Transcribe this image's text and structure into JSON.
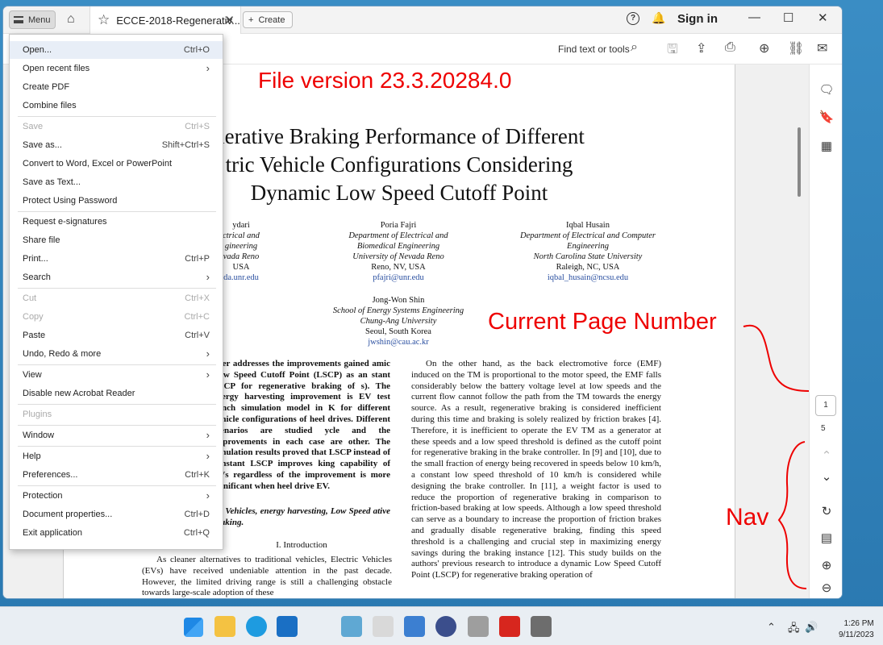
{
  "titlebar": {
    "menu_label": "Menu",
    "tab_title": "ECCE-2018-Regenerativ...",
    "create_label": "Create",
    "signin_label": "Sign in"
  },
  "toolbar": {
    "find_label": "Find text or tools"
  },
  "annotations": {
    "file_version": "File version 23.3.20284.0",
    "current_page": "Current Page Number",
    "nav": "Nav"
  },
  "navigation": {
    "current_page": "1",
    "total_pages": "5"
  },
  "menu": {
    "items": [
      {
        "label": "Open...",
        "shortcut": "Ctrl+O"
      },
      {
        "label": "Open recent files",
        "shortcut": "›"
      },
      {
        "label": "Create PDF",
        "shortcut": ""
      },
      {
        "label": "Combine files",
        "shortcut": ""
      },
      {
        "label": "Save",
        "shortcut": "Ctrl+S"
      },
      {
        "label": "Save as...",
        "shortcut": "Shift+Ctrl+S"
      },
      {
        "label": "Convert to Word, Excel or PowerPoint",
        "shortcut": ""
      },
      {
        "label": "Save as Text...",
        "shortcut": ""
      },
      {
        "label": "Protect Using Password",
        "shortcut": ""
      },
      {
        "label": "Request e-signatures",
        "shortcut": ""
      },
      {
        "label": "Share file",
        "shortcut": ""
      },
      {
        "label": "Print...",
        "shortcut": "Ctrl+P"
      },
      {
        "label": "Search",
        "shortcut": "›"
      },
      {
        "label": "Cut",
        "shortcut": "Ctrl+X"
      },
      {
        "label": "Copy",
        "shortcut": "Ctrl+C"
      },
      {
        "label": "Paste",
        "shortcut": "Ctrl+V"
      },
      {
        "label": "Undo, Redo & more",
        "shortcut": "›"
      },
      {
        "label": "View",
        "shortcut": "›"
      },
      {
        "label": "Disable new Acrobat Reader",
        "shortcut": ""
      },
      {
        "label": "Plugins",
        "shortcut": ""
      },
      {
        "label": "Window",
        "shortcut": "›"
      },
      {
        "label": "Help",
        "shortcut": "›"
      },
      {
        "label": "Preferences...",
        "shortcut": "Ctrl+K"
      },
      {
        "label": "Protection",
        "shortcut": "›"
      },
      {
        "label": "Document properties...",
        "shortcut": "Ctrl+D"
      },
      {
        "label": "Exit application",
        "shortcut": "Ctrl+Q"
      }
    ]
  },
  "document": {
    "title_lines": [
      "nerative Braking Performance of Different",
      "tric Vehicle Configurations Considering",
      "Dynamic Low Speed Cutoff Point"
    ],
    "author1": [
      "ydari",
      "ctrical and",
      "gineering",
      "vada Reno",
      "USA",
      "da.unr.edu"
    ],
    "author2": [
      "Poria Fajri",
      "Department of Electrical and",
      "Biomedical Engineering",
      "University of Nevada Reno",
      "Reno, NV, USA",
      "pfajri@unr.edu"
    ],
    "author3": [
      "Iqbal Husain",
      "Department of Electrical and Computer",
      "Engineering",
      "North Carolina State University",
      "Raleigh, NC, USA",
      "iqbal_husain@ncsu.edu"
    ],
    "author4": [
      "Jong-Won Shin",
      "School of Energy Systems Engineering",
      "Chung-Ang University",
      "Seoul, South Korea",
      "jwshin@cau.ac.kr"
    ],
    "left_col": "aper addresses the improvements gained amic Low Speed Cutoff Point (LSCP) as an stant LSCP for regenerative braking of s). The energy harvesting improvement is EV test bench simulation model in K for different vehicle configurations of heel drives. Different scenarios are studied ycle and the improvements in each case are other. The simulation results proved that LSCP instead of constant LSCP improves king capability of EVs regardless of the improvement is more significant when heel drive EV.",
    "keywords": "ric Vehicles, energy harvesting, Low Speed ative braking.",
    "section": "I.  Introduction",
    "intro": "As cleaner alternatives to traditional vehicles, Electric Vehicles (EVs) have received undeniable attention in the past decade. However, the limited driving range is still a challenging obstacle towards large-scale adoption of these",
    "right_col": "On the other hand, as the back electromotive force (EMF) induced on the TM is proportional to the motor speed, the EMF falls considerably below the battery voltage level at low speeds and the current flow cannot follow the path from the TM towards the energy source. As a result, regenerative braking is considered inefficient during this time and braking is solely realized by friction brakes [4]. Therefore, it is inefficient to operate the EV TM as a generator at these speeds and a low speed threshold is defined as the cutoff point for regenerative braking in the brake controller. In [9] and [10], due to the small fraction of energy being recovered in speeds below 10 km/h, a constant low speed threshold of 10 km/h is considered while designing the brake controller. In [11], a weight factor is used to reduce the proportion of regenerative braking in comparison to friction-based braking at low speeds. Although a low speed threshold can serve as a boundary to increase the proportion of friction brakes and gradually disable regenerative braking, finding this speed threshold is a challenging and crucial step in maximizing energy savings during the braking instance [12]. This study builds on the authors' previous research to introduce a dynamic Low Speed Cutoff Point (LSCP) for regenerative braking operation of"
  },
  "taskbar": {
    "time": "1:26 PM",
    "date": "9/11/2023"
  }
}
